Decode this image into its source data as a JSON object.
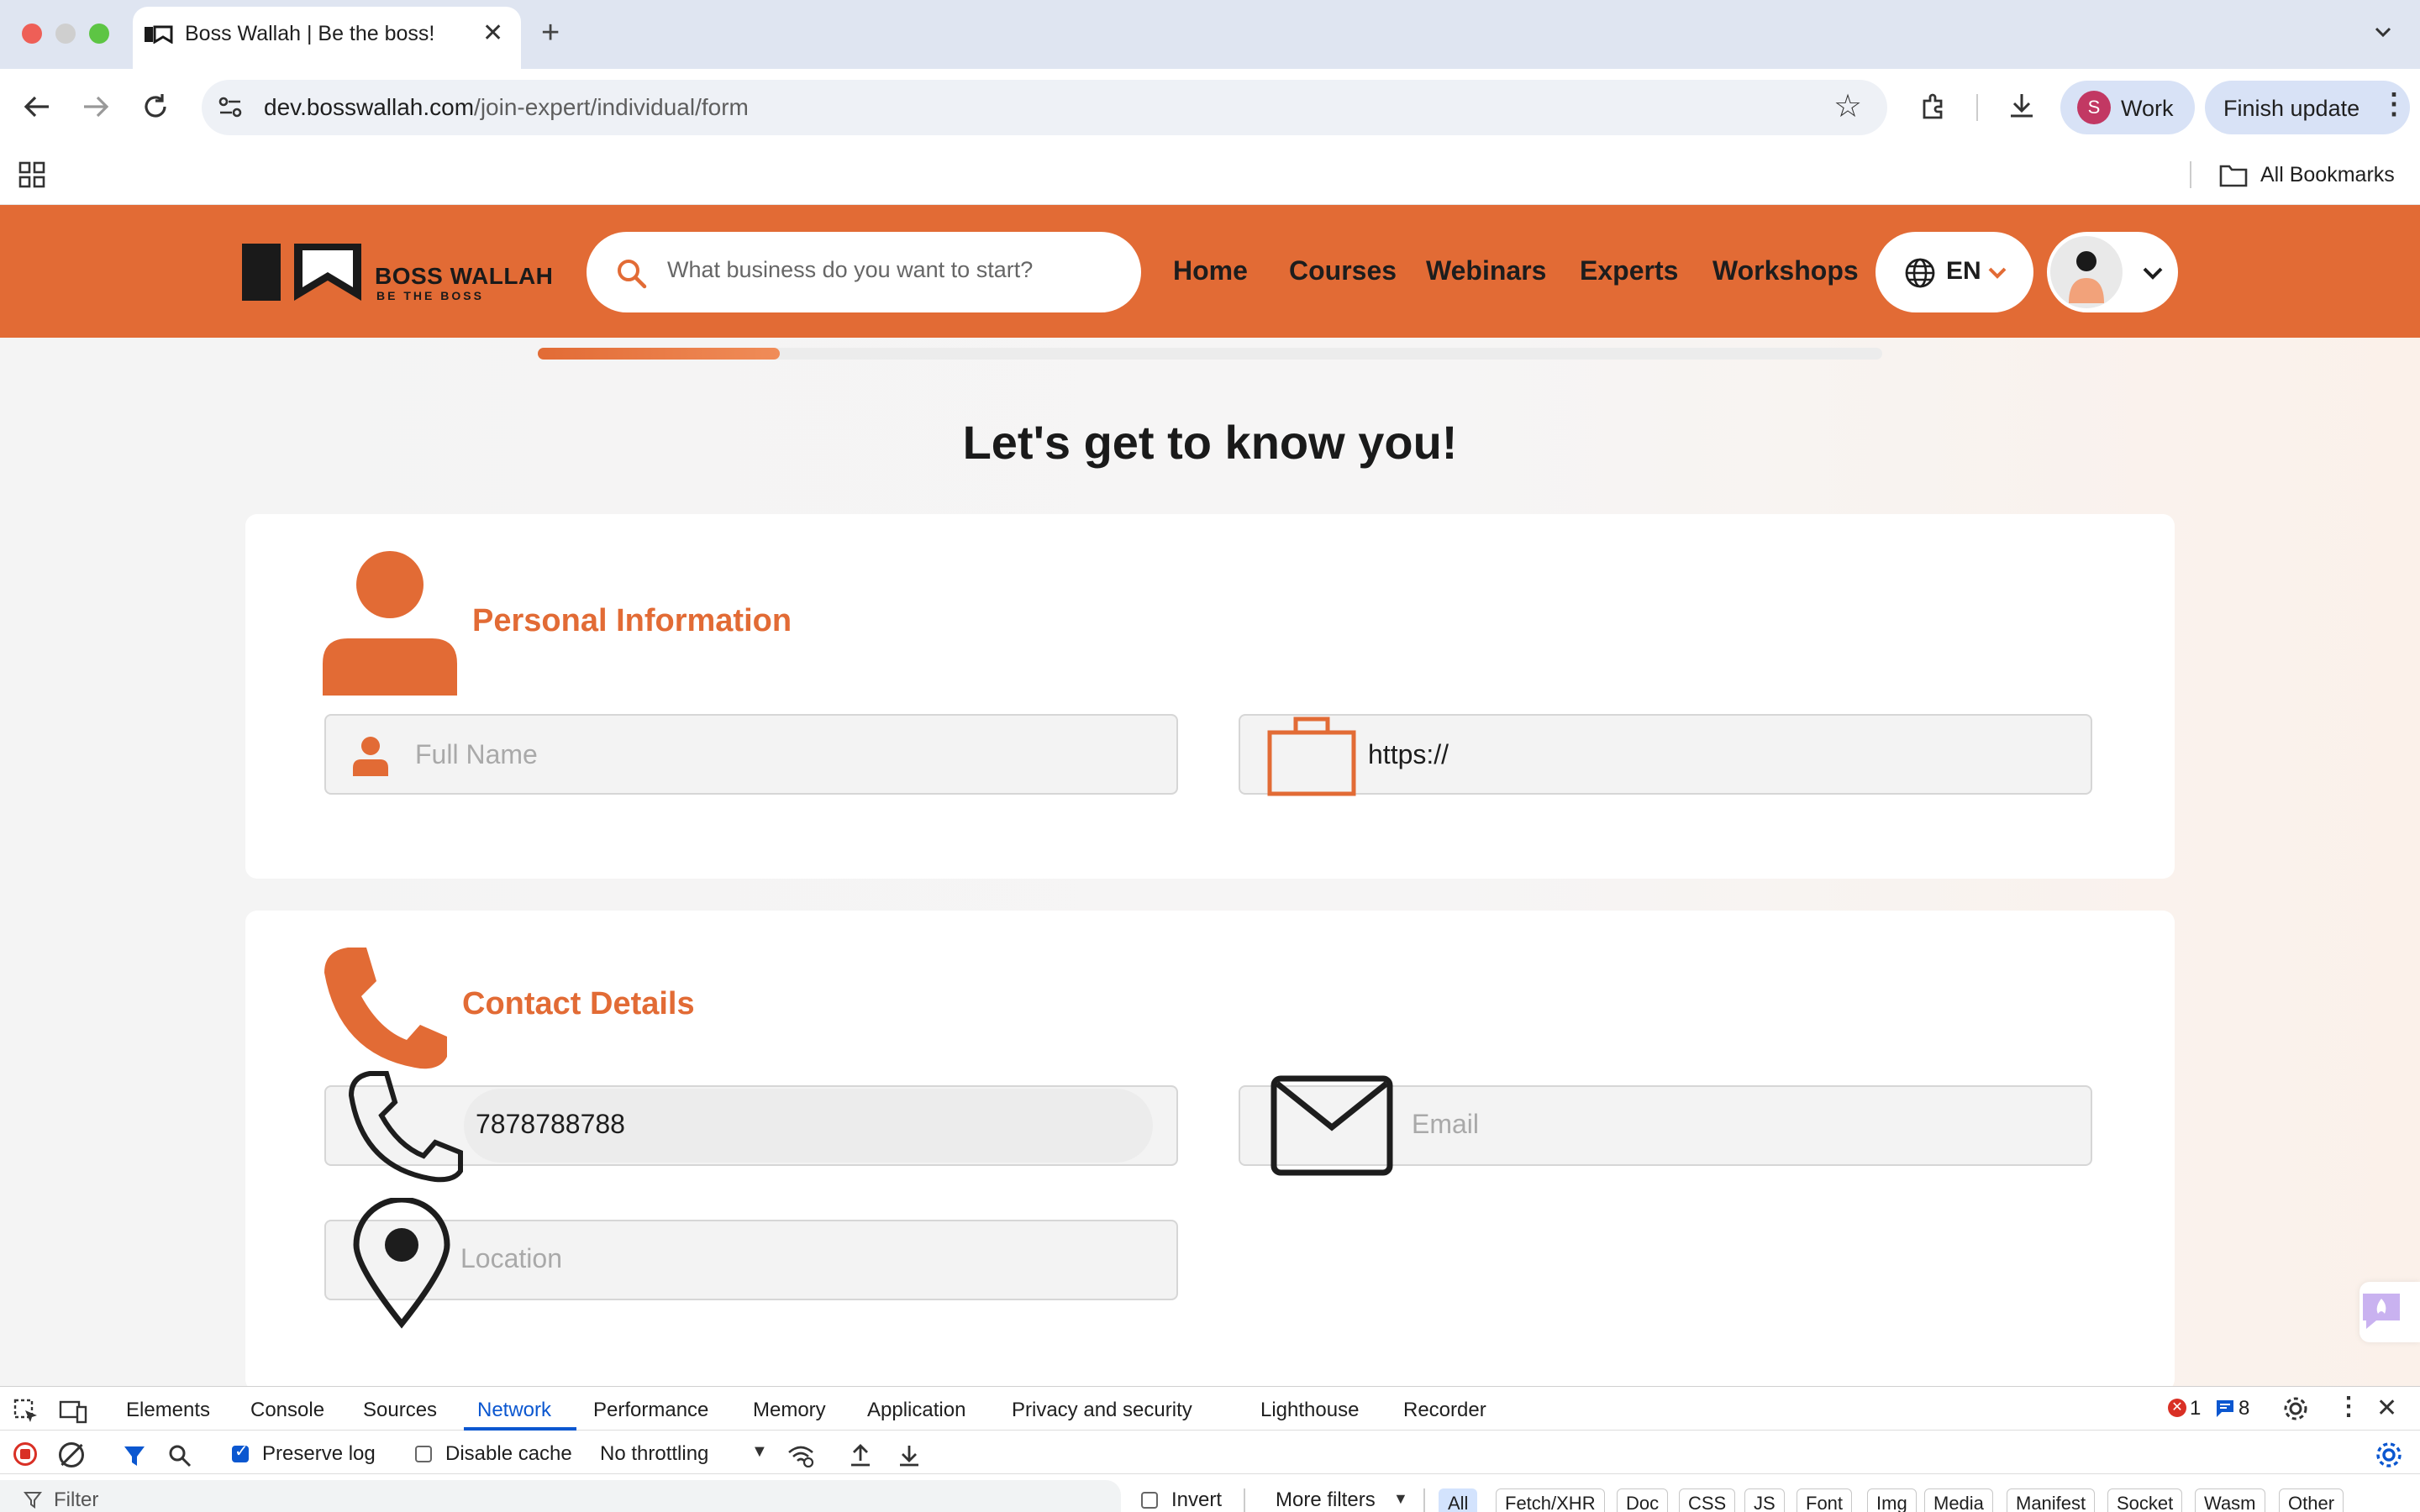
{
  "browser": {
    "tab_title": "Boss Wallah | Be the boss!",
    "url_host": "dev.bosswallah.com",
    "url_path": "/join-expert/individual/form",
    "profile_initial": "S",
    "profile_label": "Work",
    "update_label": "Finish update",
    "bookmarks_label": "All Bookmarks"
  },
  "site": {
    "logo_title": "BOSS WALLAH",
    "logo_tagline": "BE THE BOSS",
    "search_placeholder": "What business do you want to start?",
    "nav": [
      "Home",
      "Courses",
      "Webinars",
      "Experts",
      "Workshops"
    ],
    "language": "EN",
    "brand_color": "#e26b35"
  },
  "form": {
    "progress_fraction": 0.18,
    "title": "Let's get to know you!",
    "personal": {
      "title": "Personal Information",
      "full_name_placeholder": "Full Name",
      "website_value": "https://"
    },
    "contact": {
      "title": "Contact Details",
      "phone_value": "7878788788",
      "email_placeholder": "Email",
      "location_placeholder": "Location"
    }
  },
  "devtools": {
    "tabs": [
      "Elements",
      "Console",
      "Sources",
      "Network",
      "Performance",
      "Memory",
      "Application",
      "Privacy and security",
      "Lighthouse",
      "Recorder"
    ],
    "active_tab": "Network",
    "error_count": "1",
    "message_count": "8",
    "preserve_log_label": "Preserve log",
    "disable_cache_label": "Disable cache",
    "throttling_label": "No throttling",
    "filter_placeholder": "Filter",
    "invert_label": "Invert",
    "more_filters_label": "More filters",
    "type_filters": [
      "All",
      "Fetch/XHR",
      "Doc",
      "CSS",
      "JS",
      "Font",
      "Img",
      "Media",
      "Manifest",
      "Socket",
      "Wasm",
      "Other"
    ]
  }
}
